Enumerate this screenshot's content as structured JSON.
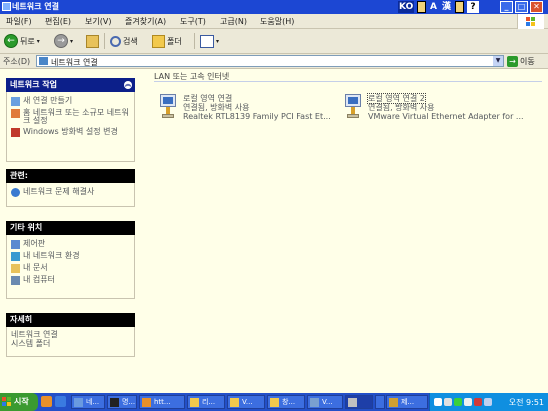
{
  "window": {
    "title": "네트워크 연결"
  },
  "ime": {
    "lang": "KO",
    "a": "A",
    "han": "漢",
    "help": "?"
  },
  "window_buttons": {
    "minimize": "_",
    "maximize": "□",
    "close": "✕"
  },
  "menu": [
    "파일(F)",
    "편집(E)",
    "보기(V)",
    "즐겨찾기(A)",
    "도구(T)",
    "고급(N)",
    "도움말(H)"
  ],
  "toolbar": {
    "back": "뒤로",
    "forward": "",
    "search": "검색",
    "folders": "폴더",
    "views": ""
  },
  "address": {
    "label": "주소(D)",
    "value": "네트워크 연결",
    "go": "이동"
  },
  "panels": {
    "network_tasks": {
      "title": "네트워크 작업",
      "items": [
        "새 연결 만들기",
        "홈 네트워크 또는 소규모 네트워크 설정",
        "Windows 방화벽 설정 변경"
      ]
    },
    "see_also": {
      "title": "관련:",
      "items": [
        "네트워크 문제 해결사"
      ]
    },
    "other_places": {
      "title": "기타 위치",
      "items": [
        "제어판",
        "내 네트워크 환경",
        "내 문서",
        "내 컴퓨터"
      ]
    },
    "details": {
      "title": "자세히",
      "line1": "네트워크 연결",
      "line2": "시스템 폴더"
    }
  },
  "group": {
    "header": "LAN 또는 고속 인터넷"
  },
  "connections": [
    {
      "name": "로컬 영역 연결",
      "status": "연결됨, 방화벽 사용",
      "device": "Realtek RTL8139 Family PCI Fast Et..."
    },
    {
      "name": "로컬 영역 연결 2",
      "status": "연결됨, 방화벽 사용",
      "device": "VMware Virtual Ethernet Adapter for ..."
    }
  ],
  "taskbar": {
    "start": "시작",
    "buttons": [
      "네...",
      "명...",
      "htt...",
      "리...",
      "V...",
      "창...",
      "V...",
      "",
      "",
      "제..."
    ],
    "clock": "오전 9:51"
  },
  "colors": {
    "titlebar": "#1c47d3",
    "panel_header_blue": "#0c1f8a",
    "panel_header_black": "#000000",
    "background": "#ffffe8",
    "taskbar": "#2350c8"
  }
}
